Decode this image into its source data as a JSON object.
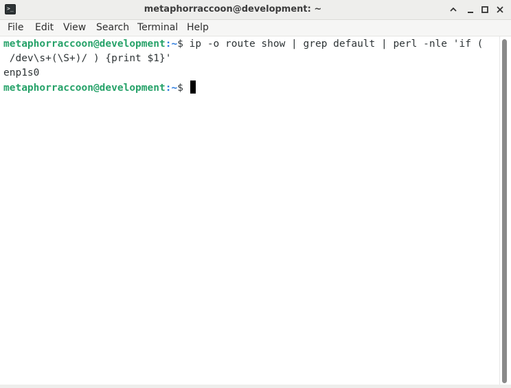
{
  "window": {
    "title": "metaphorraccoon@development: ~",
    "app_icon": "terminal-icon",
    "app_icon_glyph": ">_",
    "controls": [
      "chevron-up-icon",
      "minimize-icon",
      "maximize-icon",
      "close-icon"
    ]
  },
  "menu": {
    "items": [
      "File",
      "Edit",
      "View",
      "Search",
      "Terminal",
      "Help"
    ]
  },
  "terminal": {
    "prompt_user_host": "metaphorraccoon@development",
    "prompt_sep": ":",
    "prompt_path": "~",
    "prompt_symbol": "$ ",
    "command_line_1": "ip -o route show | grep default | perl -nle 'if (",
    "command_line_2": " /dev\\s+(\\S+)/ ) {print $1}'",
    "output_line_1": "enp1s0",
    "colors": {
      "user_host": "#26a269",
      "path": "#2a7bde",
      "text": "#2e3436"
    }
  }
}
